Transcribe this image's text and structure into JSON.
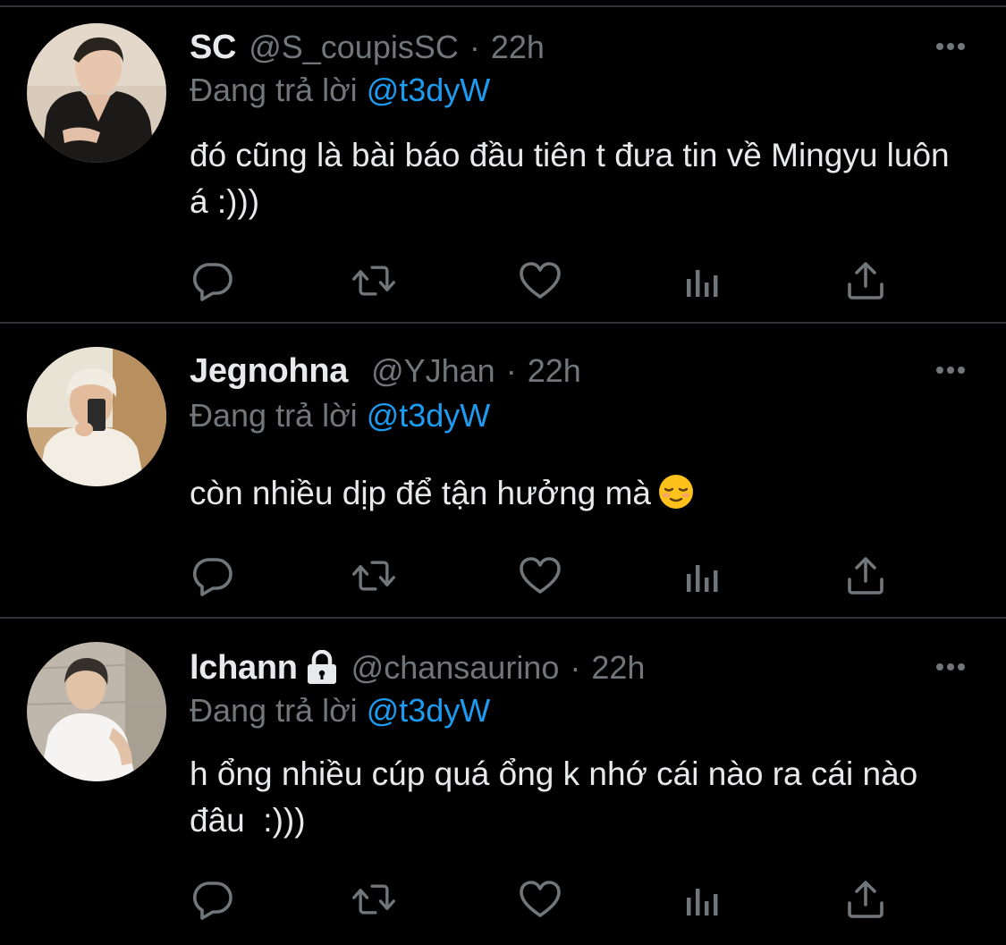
{
  "colors": {
    "background": "#000000",
    "text": "#e7e9ea",
    "secondary": "#71767b",
    "link": "#1d9bf0",
    "divider": "#2f3336"
  },
  "reply_prefix": "Đang trả lời",
  "tweets": [
    {
      "name": "SC",
      "handle": "@S_coupisSC",
      "separator": "·",
      "time": "22h",
      "reply_to": "@t3dyW",
      "text": "đó cũng là bài báo đầu tiên t đưa tin về Mingyu luôn á :)))",
      "locked": false,
      "avatar_icon": "avatar-photo"
    },
    {
      "name": "Jegnohna",
      "handle": "@YJhan",
      "separator": "·",
      "time": "22h",
      "reply_to": "@t3dyW",
      "text": "còn nhiều dịp để tận hưởng mà",
      "emoji": "relieved-face-emoji",
      "locked": false,
      "avatar_icon": "avatar-photo"
    },
    {
      "name": "lchann",
      "handle": "@chansaurino",
      "separator": "·",
      "time": "22h",
      "reply_to": "@t3dyW",
      "text": "h ổng nhiều cúp quá ổng k nhớ cái nào ra cái nào đâu  :)))",
      "locked": true,
      "avatar_icon": "avatar-photo"
    }
  ],
  "action_icons": [
    "reply-icon",
    "retweet-icon",
    "like-icon",
    "views-icon",
    "share-icon"
  ],
  "more_icon": "more-options-icon"
}
